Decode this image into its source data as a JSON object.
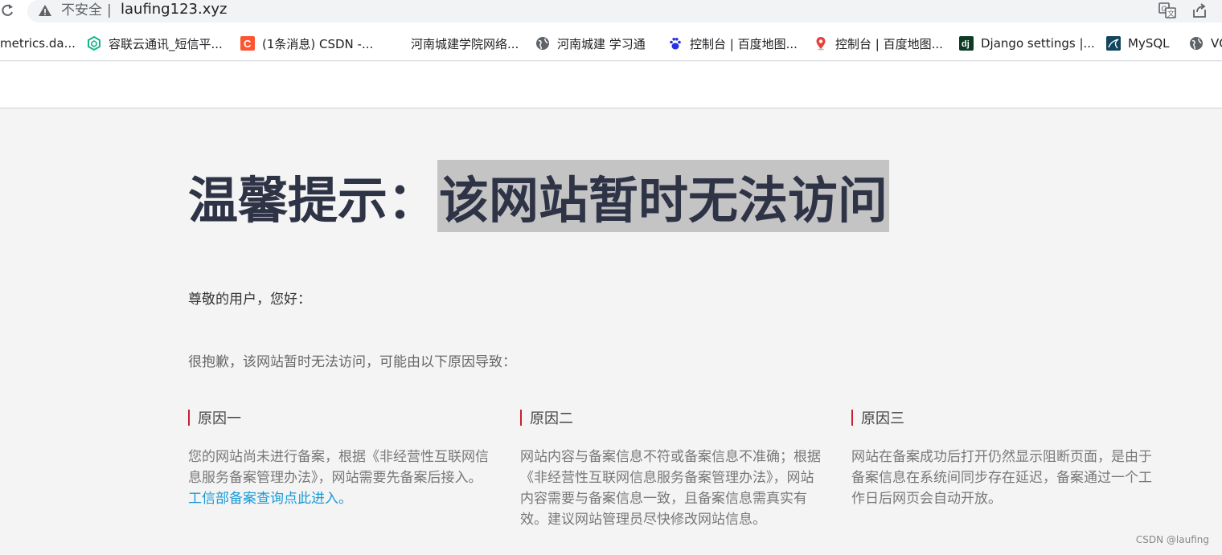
{
  "browser": {
    "security_label": "不安全",
    "separator": "|",
    "url": "laufing123.xyz"
  },
  "bookmarks": [
    {
      "label": "metrics.da...",
      "icon": "none"
    },
    {
      "label": "容联云通讯_短信平...",
      "icon": "ronglian-icon"
    },
    {
      "label": "(1条消息) CSDN -...",
      "icon": "csdn-icon"
    },
    {
      "label": "河南城建学院网络...",
      "icon": "none"
    },
    {
      "label": "河南城建  学习通",
      "icon": "globe-icon"
    },
    {
      "label": "控制台 | 百度地图...",
      "icon": "baidu-paw-icon"
    },
    {
      "label": "控制台 | 百度地图...",
      "icon": "map-pin-icon"
    },
    {
      "label": "Django settings |...",
      "icon": "django-icon"
    },
    {
      "label": "MySQL",
      "icon": "mysql-icon"
    },
    {
      "label": "VC",
      "icon": "globe-icon"
    }
  ],
  "page": {
    "title_prefix": "温馨提示：",
    "title_highlight": "该网站暂时无法访问",
    "greeting": "尊敬的用户，您好：",
    "sorry": "很抱歉，该网站暂时无法访问，可能由以下原因导致：",
    "reasons": [
      {
        "title": "原因一",
        "text": "您的网站尚未进行备案，根据《非经营性互联网信息服务备案管理办法》，网站需要先备案后接入。",
        "link": "工信部备案查询点此进入。"
      },
      {
        "title": "原因二",
        "text": "网站内容与备案信息不符或备案信息不准确；根据《非经营性互联网信息服务备案管理办法》，网站内容需要与备案信息一致，且备案信息需真实有效。建议网站管理员尽快修改网站信息。"
      },
      {
        "title": "原因三",
        "text": "网站在备案成功后打开仍然显示阻断页面，是由于备案信息在系统间同步存在延迟，备案通过一个工作日后网页会自动开放。"
      }
    ]
  },
  "watermark": "CSDN @laufing",
  "colors": {
    "accent_red": "#c8202e",
    "link_blue": "#1a9ad6",
    "highlight_gray": "#c4c4c4"
  }
}
